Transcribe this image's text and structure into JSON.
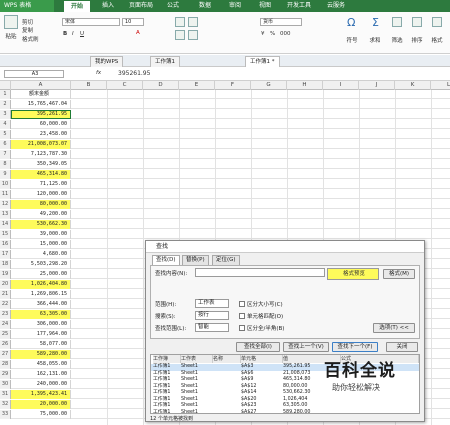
{
  "app": {
    "name": "WPS 表格"
  },
  "menu": [
    "开始",
    "插入",
    "页面布局",
    "公式",
    "数据",
    "审阅",
    "视图",
    "开发工具",
    "云服务"
  ],
  "ribbon": {
    "paste": "粘贴",
    "cut": "剪切",
    "copy": "复制",
    "format_painter": "格式刷",
    "font": "宋体",
    "font_size": "10",
    "number_format": "货币",
    "currency_symbol": "¥",
    "percent": "%",
    "thousands": "000",
    "sum": "求和",
    "filter": "筛选",
    "sort": "排序",
    "format": "格式",
    "symbol": "符号",
    "rowcol": "行和列"
  },
  "doc_tabs": [
    "我的WPS",
    "工作簿1",
    "工作簿1 *"
  ],
  "formula_bar": {
    "name_box": "A3",
    "fx": "fx",
    "value": "395261.95"
  },
  "columns": [
    "A",
    "B",
    "C",
    "D",
    "E",
    "F",
    "G",
    "H",
    "I",
    "J",
    "K",
    "L"
  ],
  "sheet": {
    "header": "额末金额",
    "rows": [
      {
        "n": "1",
        "v": "额末金额",
        "hl": false
      },
      {
        "n": "2",
        "v": "15,765,467.04",
        "hl": false
      },
      {
        "n": "3",
        "v": "395,261.95",
        "hl": true
      },
      {
        "n": "4",
        "v": "60,000.00",
        "hl": false
      },
      {
        "n": "5",
        "v": "23,458.00",
        "hl": false
      },
      {
        "n": "6",
        "v": "21,008,073.07",
        "hl": true
      },
      {
        "n": "7",
        "v": "7,123,787.30",
        "hl": false
      },
      {
        "n": "8",
        "v": "350,349.05",
        "hl": false
      },
      {
        "n": "9",
        "v": "465,314.80",
        "hl": true
      },
      {
        "n": "10",
        "v": "71,125.00",
        "hl": false
      },
      {
        "n": "11",
        "v": "120,000.00",
        "hl": false
      },
      {
        "n": "12",
        "v": "80,000.00",
        "hl": true
      },
      {
        "n": "13",
        "v": "49,200.00",
        "hl": false
      },
      {
        "n": "14",
        "v": "530,662.30",
        "hl": true
      },
      {
        "n": "15",
        "v": "39,000.00",
        "hl": false
      },
      {
        "n": "16",
        "v": "15,000.00",
        "hl": false
      },
      {
        "n": "17",
        "v": "4,680.00",
        "hl": false
      },
      {
        "n": "18",
        "v": "5,503,298.20",
        "hl": false
      },
      {
        "n": "19",
        "v": "25,000.00",
        "hl": false
      },
      {
        "n": "20",
        "v": "1,026,404.80",
        "hl": true
      },
      {
        "n": "21",
        "v": "1,269,806.15",
        "hl": false
      },
      {
        "n": "22",
        "v": "366,444.00",
        "hl": false
      },
      {
        "n": "23",
        "v": "63,305.00",
        "hl": true
      },
      {
        "n": "24",
        "v": "306,000.00",
        "hl": false
      },
      {
        "n": "25",
        "v": "177,964.00",
        "hl": false
      },
      {
        "n": "26",
        "v": "58,077.00",
        "hl": false
      },
      {
        "n": "27",
        "v": "589,280.00",
        "hl": true
      },
      {
        "n": "28",
        "v": "458,055.00",
        "hl": false
      },
      {
        "n": "29",
        "v": "162,131.00",
        "hl": false
      },
      {
        "n": "30",
        "v": "240,000.00",
        "hl": false
      },
      {
        "n": "31",
        "v": "1,395,423.41",
        "hl": true
      },
      {
        "n": "32",
        "v": "20,000.00",
        "hl": true
      },
      {
        "n": "33",
        "v": "75,000.00",
        "hl": false
      }
    ]
  },
  "dialog": {
    "title": "查找",
    "tabs": [
      "查找(D)",
      "替换(P)",
      "定位(G)"
    ],
    "find_label": "查找内容(N):",
    "format_preview": "格式预览",
    "format_btn": "格式(M)",
    "scope_label": "范围(H):",
    "scope_value": "工作表",
    "search_label": "搜索(S):",
    "search_value": "按行",
    "lookin_label": "查找范围(L):",
    "lookin_value": "智能",
    "opt_case": "区分大小写(C)",
    "opt_whole": "单元格匹配(O)",
    "opt_width": "区分全/半角(B)",
    "options_btn": "选项(T) <<",
    "btn_find_all": "查找全部(I)",
    "btn_find_prev": "查找上一个(V)",
    "btn_find_next": "查找下一个(F)",
    "btn_close": "关闭",
    "result_headers": [
      "工作簿",
      "工作表",
      "名称",
      "单元格",
      "值",
      "公式"
    ],
    "results": [
      [
        "工作簿1",
        "Sheet1",
        "",
        "$A$3",
        "395,261.95",
        ""
      ],
      [
        "工作簿1",
        "Sheet1",
        "",
        "$A$6",
        "21,008,073",
        ""
      ],
      [
        "工作簿1",
        "Sheet1",
        "",
        "$A$9",
        "465,314.80",
        ""
      ],
      [
        "工作簿1",
        "Sheet1",
        "",
        "$A$12",
        "80,000.00",
        ""
      ],
      [
        "工作簿1",
        "Sheet1",
        "",
        "$A$14",
        "530,662.30",
        ""
      ],
      [
        "工作簿1",
        "Sheet1",
        "",
        "$A$20",
        "1,026,404",
        ""
      ],
      [
        "工作簿1",
        "Sheet1",
        "",
        "$A$23",
        "63,305.00",
        ""
      ],
      [
        "工作簿1",
        "Sheet1",
        "",
        "$A$27",
        "589,280.00",
        ""
      ]
    ],
    "status": "12 个单元格被找到"
  },
  "watermark": {
    "title": "百科全说",
    "subtitle": "助你轻松解决"
  }
}
